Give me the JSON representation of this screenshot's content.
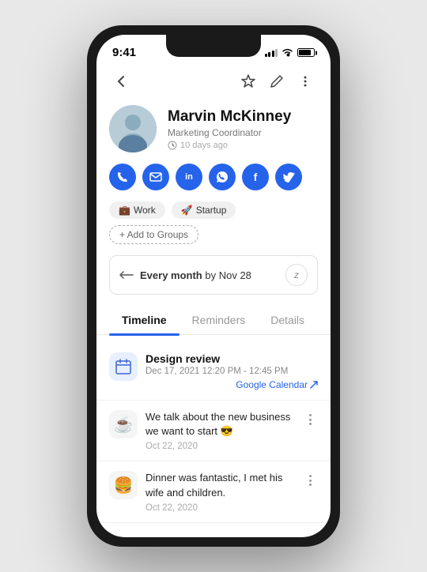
{
  "status": {
    "time": "9:41",
    "battery_pct": 85
  },
  "header": {
    "back_label": "←",
    "star_label": "☆",
    "edit_label": "✎",
    "more_label": "⋮"
  },
  "profile": {
    "name": "Marvin McKinney",
    "title": "Marketing Coordinator",
    "time_ago": "10 days ago",
    "avatar_emoji": "😊"
  },
  "social_buttons": [
    {
      "id": "phone",
      "icon": "📞",
      "symbol": "✆"
    },
    {
      "id": "email",
      "icon": "✉",
      "symbol": "✉"
    },
    {
      "id": "linkedin",
      "icon": "in",
      "symbol": "in"
    },
    {
      "id": "whatsapp",
      "icon": "W",
      "symbol": "W"
    },
    {
      "id": "facebook",
      "icon": "f",
      "symbol": "f"
    },
    {
      "id": "twitter",
      "icon": "t",
      "symbol": "t"
    }
  ],
  "tags": [
    {
      "id": "work",
      "emoji": "💼",
      "label": "Work"
    },
    {
      "id": "startup",
      "emoji": "🚀",
      "label": "Startup"
    }
  ],
  "add_group_label": "+ Add to Groups",
  "reminder": {
    "prefix": "Every month",
    "suffix": "by Nov 28",
    "snooze_label": "z"
  },
  "tabs": [
    {
      "id": "timeline",
      "label": "Timeline",
      "active": true
    },
    {
      "id": "reminders",
      "label": "Reminders",
      "active": false
    },
    {
      "id": "details",
      "label": "Details",
      "active": false
    }
  ],
  "timeline_items": [
    {
      "id": "design-review",
      "avatar_emoji": "🟦",
      "avatar_bg": "#e8f0ff",
      "title": "Design review",
      "date": "Dec 17, 2021 12:20 PM - 12:45 PM",
      "link_label": "Google Calendar",
      "has_link": true
    },
    {
      "id": "business-talk",
      "avatar_emoji": "☕",
      "avatar_bg": "#f5f5f5",
      "text": "We talk about the new business we want to start 😎",
      "date": "Oct 22, 2020",
      "has_link": false
    },
    {
      "id": "dinner",
      "avatar_emoji": "🍔",
      "avatar_bg": "#f5f5f5",
      "text": "Dinner was fantastic, I met his wife and children.",
      "date": "Oct 22, 2020",
      "has_link": false
    }
  ]
}
